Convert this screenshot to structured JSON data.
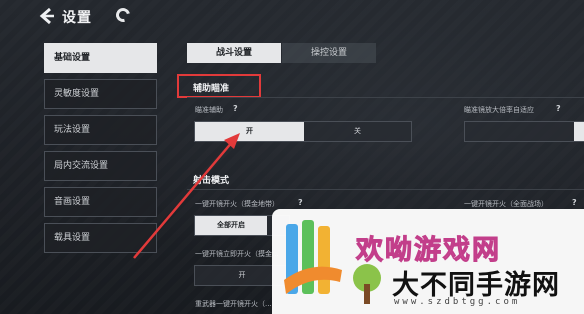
{
  "header": {
    "title": "设置"
  },
  "sidebar": {
    "items": [
      {
        "label": "基础设置",
        "active": true
      },
      {
        "label": "灵敏度设置",
        "active": false
      },
      {
        "label": "玩法设置",
        "active": false
      },
      {
        "label": "局内交流设置",
        "active": false
      },
      {
        "label": "音画设置",
        "active": false
      },
      {
        "label": "载具设置",
        "active": false
      }
    ]
  },
  "tabs": [
    {
      "label": "战斗设置",
      "active": true
    },
    {
      "label": "操控设置",
      "active": false
    }
  ],
  "aim_section": {
    "title": "辅助瞄准",
    "aim_assist": {
      "label": "瞄准辅助",
      "help": "?",
      "on": "开",
      "off": "关",
      "selected": "开"
    },
    "scope_adapt": {
      "label": "瞄准镜放大倍率自适应",
      "help": "?"
    }
  },
  "fire_section": {
    "title": "射击模式",
    "scope_fire_loot": {
      "label": "一键开镜开火（摸金地带）",
      "help": "?",
      "option": "全部开启"
    },
    "scope_fire_all": {
      "label": "一键开镜开火（全面战场）",
      "help": "?"
    },
    "scope_fire_stand": {
      "label": "一键开镜立即开火（摸金...",
      "option": "开"
    },
    "heavy_weapon": {
      "label": "重武器一键开镜开火（..."
    }
  },
  "watermark": {
    "brand": "欢呦游戏网",
    "name": "大不同手游网",
    "url": "www.szdbtgg.com"
  },
  "colors": {
    "accent_red": "#e23a3a",
    "active_bg": "#e6e7e9",
    "brand_pink": "#e85aa8"
  }
}
